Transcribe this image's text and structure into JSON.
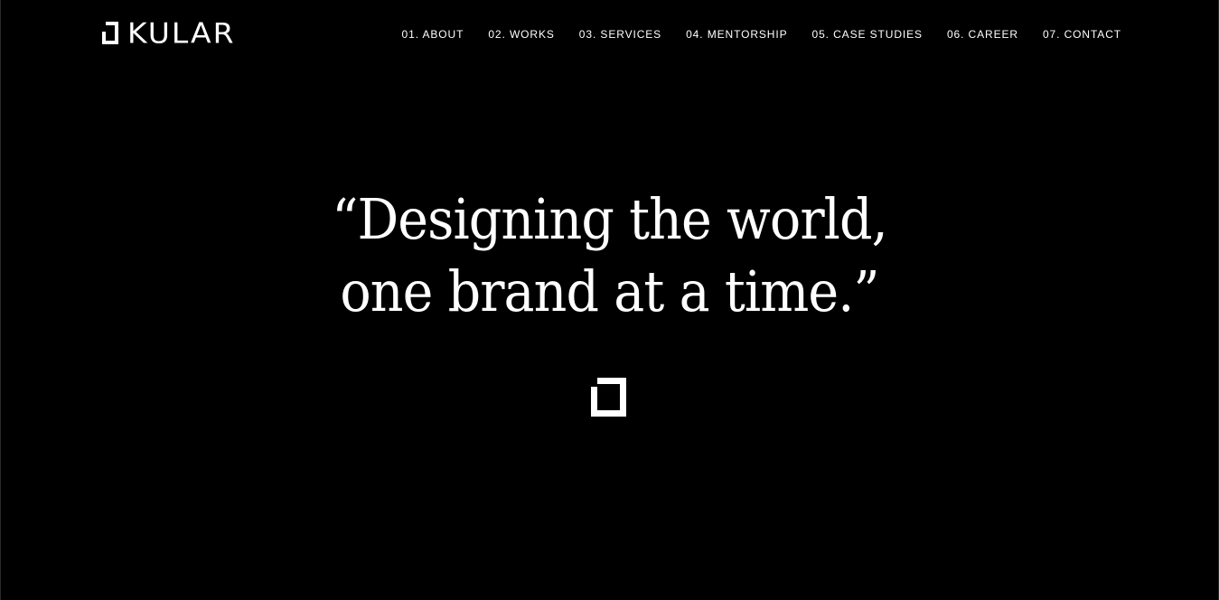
{
  "brand": {
    "name": "KULAR"
  },
  "nav": {
    "items": [
      {
        "label": "01. ABOUT"
      },
      {
        "label": "02. WORKS"
      },
      {
        "label": "03. SERVICES"
      },
      {
        "label": "04. MENTORSHIP"
      },
      {
        "label": "05. CASE STUDIES"
      },
      {
        "label": "06. CAREER"
      },
      {
        "label": "07. CONTACT"
      }
    ]
  },
  "hero": {
    "line1": "“Designing the world,",
    "line2": "one brand at a time.”"
  },
  "colors": {
    "background": "#000000",
    "foreground": "#ffffff"
  },
  "icons": {
    "logo_mark": "kular-bracket-icon",
    "hero_mark": "kular-bracket-icon"
  }
}
